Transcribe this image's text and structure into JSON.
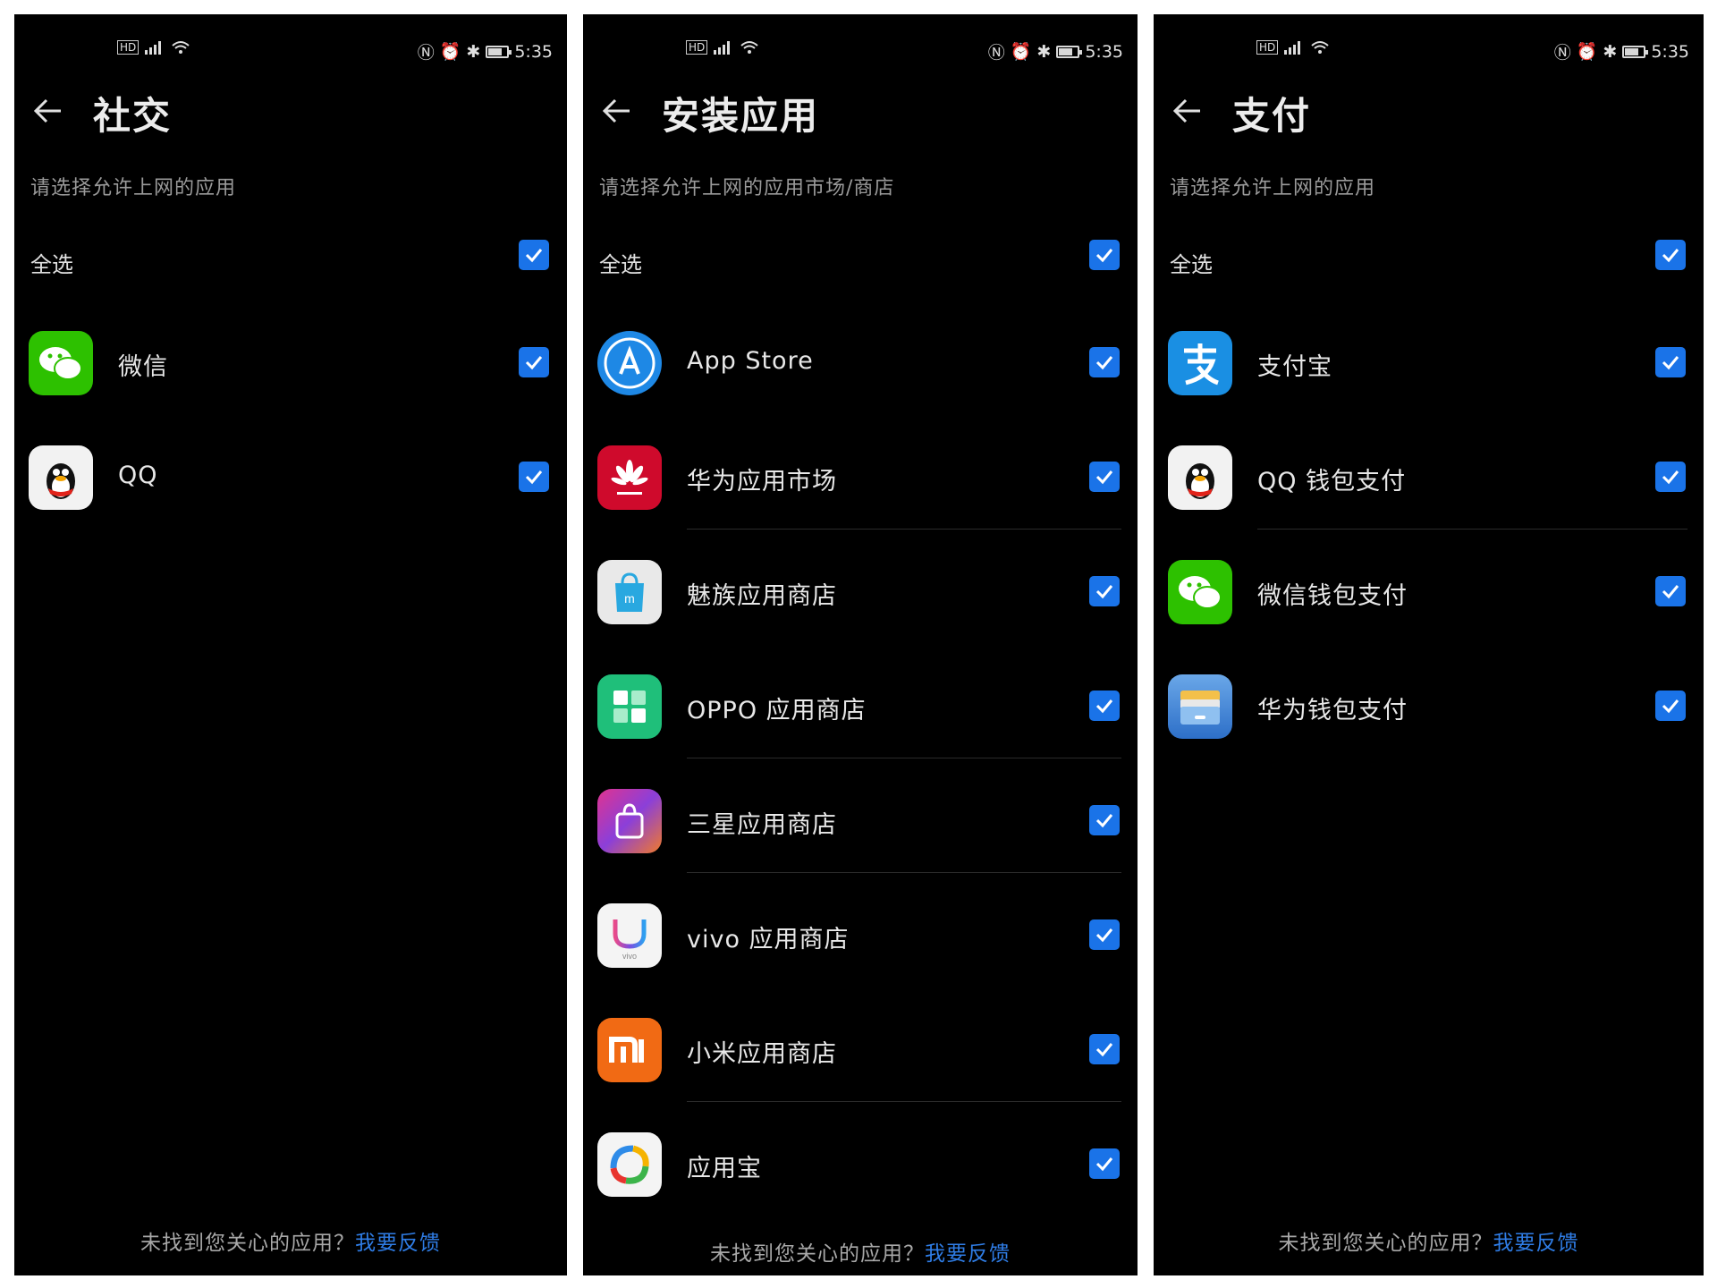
{
  "status": {
    "time": "5:35"
  },
  "colors": {
    "accent": "#1a73e8",
    "link": "#2f7de6",
    "background": "#000000"
  },
  "panels": [
    {
      "title": "社交",
      "subtitle": "请选择允许上网的应用",
      "select_all": "全选",
      "items": [
        {
          "label": "微信",
          "icon": "wechat-icon",
          "checked": true
        },
        {
          "label": "QQ",
          "icon": "qq-icon",
          "checked": true
        }
      ],
      "footer_text": "未找到您关心的应用？",
      "footer_link": "我要反馈"
    },
    {
      "title": "安装应用",
      "subtitle": "请选择允许上网的应用市场/商店",
      "select_all": "全选",
      "items": [
        {
          "label": "App Store",
          "icon": "app-store-icon",
          "checked": true
        },
        {
          "label": "华为应用市场",
          "icon": "huawei-appgallery-icon",
          "checked": true
        },
        {
          "label": "魅族应用商店",
          "icon": "meizu-store-icon",
          "checked": true
        },
        {
          "label": "OPPO 应用商店",
          "icon": "oppo-store-icon",
          "checked": true
        },
        {
          "label": "三星应用商店",
          "icon": "samsung-store-icon",
          "checked": true
        },
        {
          "label": "vivo 应用商店",
          "icon": "vivo-store-icon",
          "checked": true
        },
        {
          "label": "小米应用商店",
          "icon": "xiaomi-store-icon",
          "checked": true
        },
        {
          "label": "应用宝",
          "icon": "yingyongbao-icon",
          "checked": true
        }
      ],
      "footer_text": "未找到您关心的应用？",
      "footer_link": "我要反馈"
    },
    {
      "title": "支付",
      "subtitle": "请选择允许上网的应用",
      "select_all": "全选",
      "items": [
        {
          "label": "支付宝",
          "icon": "alipay-icon",
          "checked": true
        },
        {
          "label": "QQ 钱包支付",
          "icon": "qq-icon",
          "checked": true
        },
        {
          "label": "微信钱包支付",
          "icon": "wechat-icon",
          "checked": true
        },
        {
          "label": "华为钱包支付",
          "icon": "huawei-wallet-icon",
          "checked": true
        }
      ],
      "footer_text": "未找到您关心的应用？",
      "footer_link": "我要反馈"
    }
  ]
}
